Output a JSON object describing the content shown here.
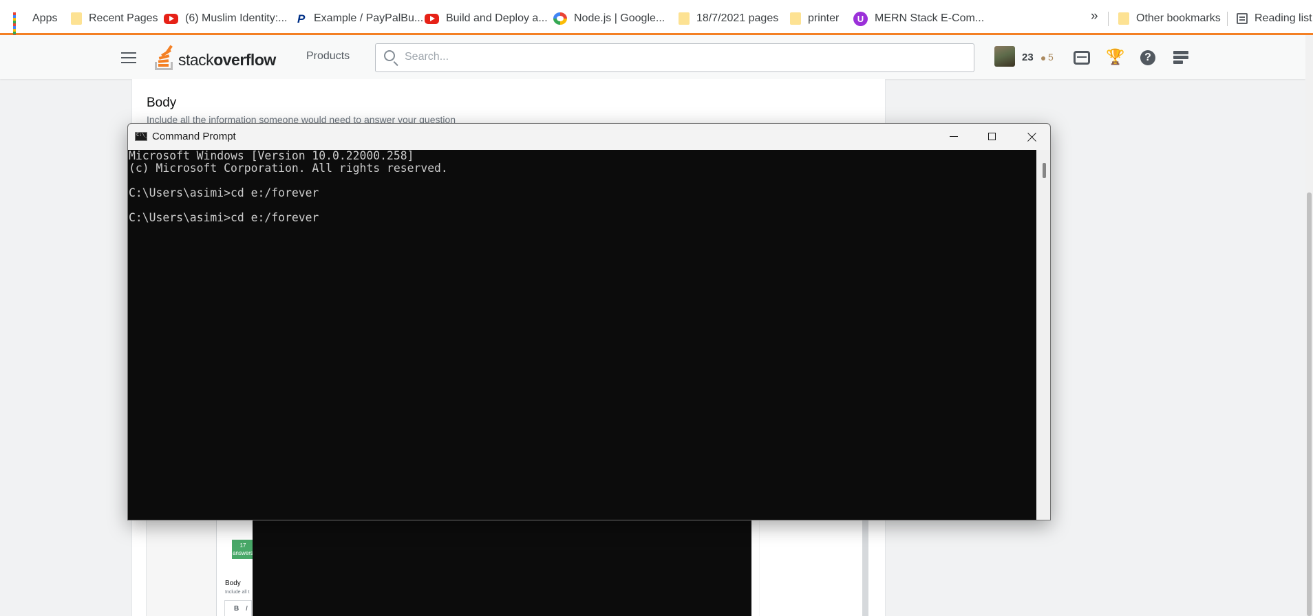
{
  "browser": {
    "bookmarks": [
      {
        "label": "Apps",
        "icon": "apps-grid-icon"
      },
      {
        "label": "Recent Pages",
        "icon": "folder-icon"
      },
      {
        "label": "(6) Muslim Identity:...",
        "icon": "youtube-icon"
      },
      {
        "label": "Example / PayPalBu...",
        "icon": "paypal-icon"
      },
      {
        "label": "Build and Deploy a...",
        "icon": "youtube-icon"
      },
      {
        "label": "Node.js  |  Google...",
        "icon": "google-cloud-icon"
      },
      {
        "label": "18/7/2021 pages",
        "icon": "folder-icon"
      },
      {
        "label": "printer",
        "icon": "folder-icon"
      },
      {
        "label": "MERN Stack E-Com...",
        "icon": "udemy-icon"
      }
    ],
    "more_label": "»",
    "other_bookmarks": "Other bookmarks",
    "reading_list": "Reading list"
  },
  "so_header": {
    "logo_light": "stack",
    "logo_bold": "overflow",
    "products": "Products",
    "search_placeholder": "Search...",
    "reputation": "23",
    "bronze_badges": "5"
  },
  "main": {
    "body_title": "Body",
    "body_description": "Include all the information someone would need to answer your question"
  },
  "nested": {
    "answers_count": "17",
    "answers_label": "answers",
    "body_title": "Body",
    "body_desc": "Include all t",
    "toolbar_bold": "B",
    "toolbar_italic": "I"
  },
  "cmd": {
    "title": "Command Prompt",
    "lines": [
      "Microsoft Windows [Version 10.0.22000.258]",
      "(c) Microsoft Corporation. All rights reserved.",
      "",
      "C:\\Users\\asimi>cd e:/forever",
      "",
      "C:\\Users\\asimi>cd e:/forever"
    ]
  },
  "colors": {
    "so_orange": "#f48024",
    "console_bg": "#0c0c0c",
    "console_text": "#cccccc",
    "bronze": "#ab8a5f",
    "trophy_green": "#2f9e4a"
  }
}
